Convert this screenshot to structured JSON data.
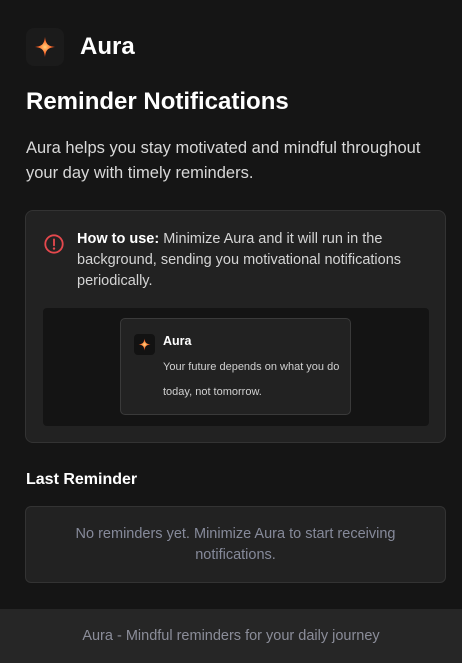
{
  "app": {
    "name": "Aura",
    "logo_icon": "sparkle-icon",
    "accent": "#ff6a2b"
  },
  "page": {
    "title": "Reminder Notifications",
    "intro": "Aura helps you stay motivated and mindful throughout your day with timely reminders."
  },
  "howto": {
    "icon": "info-icon",
    "icon_color": "#e5484d",
    "label": "How to use:",
    "text": " Minimize Aura and it will run in the background, sending you motivational notifications periodically."
  },
  "notification_preview": {
    "title": "Aura",
    "body": "Your future depends on what you do today, not tomorrow."
  },
  "last_reminder": {
    "title": "Last Reminder",
    "empty_text": "No reminders yet. Minimize Aura to start receiving notifications."
  },
  "footer": {
    "text": "Aura - Mindful reminders for your daily journey"
  }
}
